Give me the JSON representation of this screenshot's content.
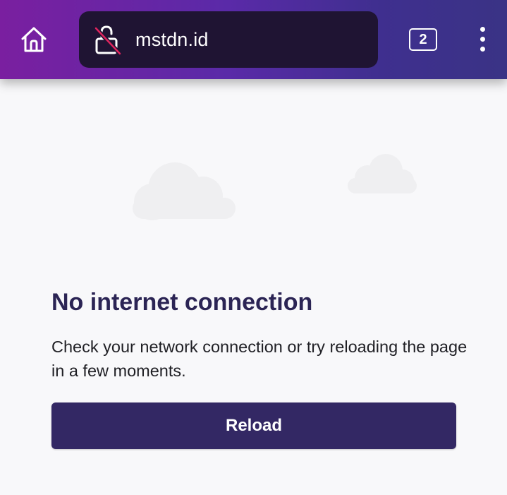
{
  "toolbar": {
    "home_icon": "home-icon",
    "security_icon": "lock-broken-icon",
    "url": "mstdn.id",
    "tab_count": "2",
    "menu_icon": "more-vertical-icon",
    "gradient_colors": [
      "#7a1fa0",
      "#5a2aa8",
      "#3a3385"
    ]
  },
  "error": {
    "title": "No internet connection",
    "message": "Check your network connection or try reloading the page in a few moments.",
    "reload_label": "Reload",
    "cloud_icon": "cloud-icon"
  },
  "colors": {
    "heading": "#2b2454",
    "button": "#332864",
    "background": "#f8f8fa",
    "cloud": "#efeff1",
    "lock_slash": "#e0245e"
  }
}
